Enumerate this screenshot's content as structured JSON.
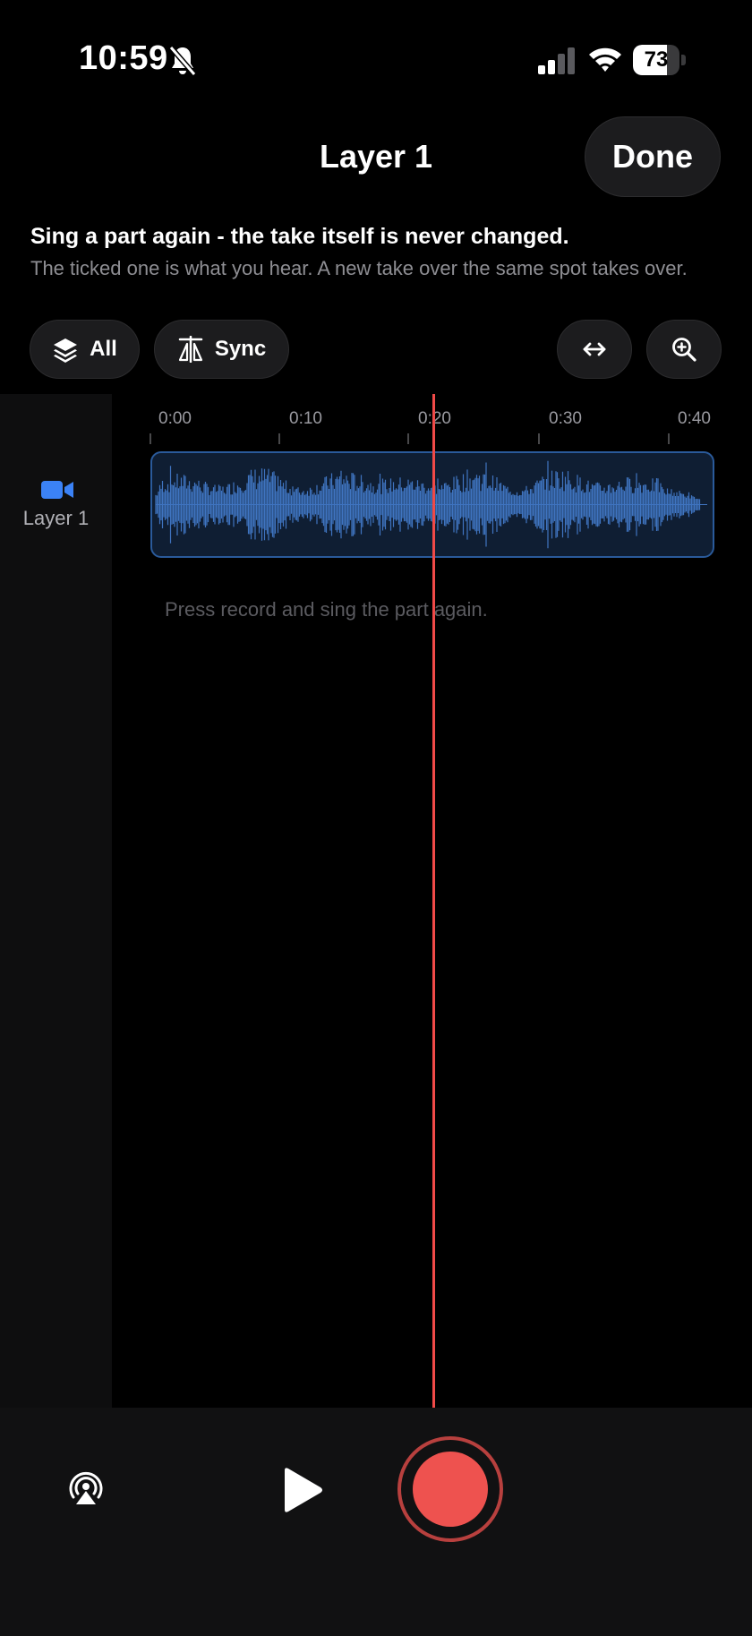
{
  "status_bar": {
    "time": "10:59",
    "battery_percent": "73",
    "battery_level": 0.73,
    "icons": [
      "bell-slash-icon",
      "cellular-signal-icon",
      "wifi-icon",
      "battery-icon"
    ]
  },
  "header": {
    "title": "Layer 1",
    "done_label": "Done"
  },
  "info": {
    "headline": "Sing a part again - the take itself is never changed.",
    "subtext": "The ticked one is what you hear. A new take over the same spot takes over."
  },
  "toolbar": {
    "all_label": "All",
    "sync_label": "Sync",
    "icons": [
      "layers-icon",
      "sync-icon",
      "fit-width-icon",
      "zoom-in-icon"
    ]
  },
  "timeline": {
    "ticks": [
      "0:00",
      "0:10",
      "0:20",
      "0:30",
      "0:40"
    ],
    "playhead_time": "0:20",
    "layer": {
      "label": "Layer 1",
      "icon": "video-camera-icon"
    },
    "hint": "Press record and sing the part again."
  },
  "controls": {
    "icons": [
      "airplay-icon",
      "play-icon",
      "record-button"
    ]
  },
  "colors": {
    "background": "#000000",
    "accent_blue": "#3b82f6",
    "waveform": "#3f74c0",
    "playhead": "#f04a48",
    "record": "#ee524f",
    "button_bg": "#1c1c1e"
  }
}
